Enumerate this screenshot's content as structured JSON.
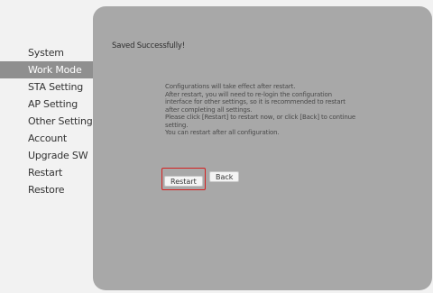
{
  "sidebar": {
    "items": [
      {
        "label": "System"
      },
      {
        "label": "Work Mode",
        "active": true
      },
      {
        "label": "STA Setting"
      },
      {
        "label": "AP Setting"
      },
      {
        "label": "Other Setting"
      },
      {
        "label": "Account"
      },
      {
        "label": "Upgrade SW"
      },
      {
        "label": "Restart"
      },
      {
        "label": "Restore"
      }
    ]
  },
  "main": {
    "status": "Saved Successfully!",
    "message_lines": [
      "Configurations will take effect after restart.",
      "After restart, you will need to re-login the configuration",
      "interface for other settings, so it is recommended to restart",
      "after completing all settings.",
      "Please click [Restart] to restart now, or click [Back] to continue",
      "setting.",
      "You can restart after all configuration."
    ],
    "restart_label": "Restart",
    "back_label": "Back"
  },
  "colors": {
    "panel": "#a8a8a8",
    "active_nav": "#8f8f8f",
    "highlight_border": "#d42020"
  }
}
